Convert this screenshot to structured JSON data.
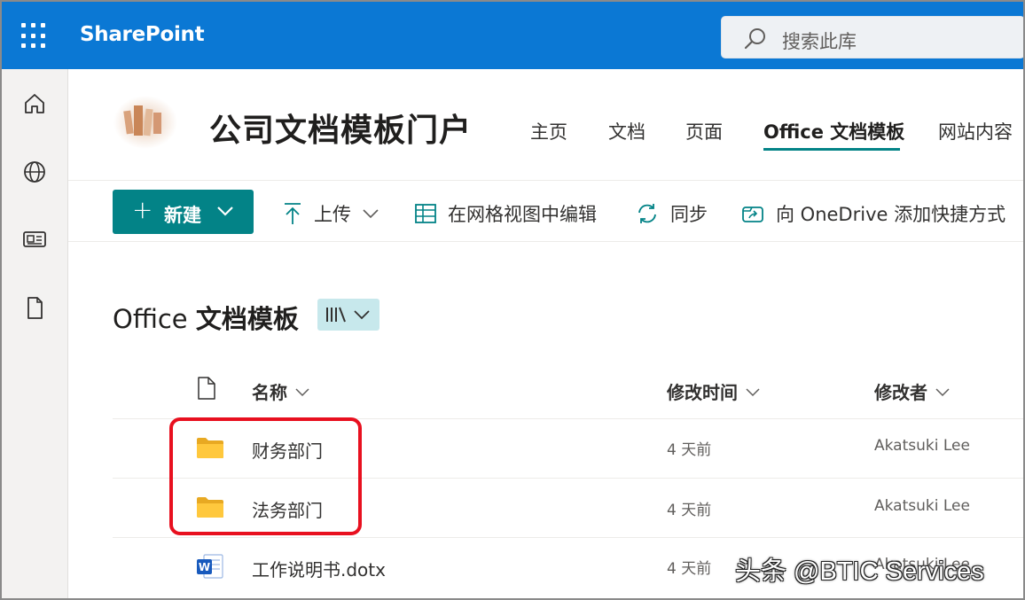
{
  "app": {
    "brand": "SharePoint",
    "search_placeholder": "搜索此库",
    "accent": "#038387",
    "topbar_color": "#0b78d4"
  },
  "rail": {
    "items": [
      {
        "name": "home",
        "icon": "home-icon"
      },
      {
        "name": "sites",
        "icon": "globe-icon"
      },
      {
        "name": "news",
        "icon": "news-icon"
      },
      {
        "name": "files",
        "icon": "document-icon"
      }
    ]
  },
  "site": {
    "title": "公司文档模板门户",
    "nav": [
      {
        "label": "主页"
      },
      {
        "label": "文档"
      },
      {
        "label": "页面"
      },
      {
        "label": "Office 文档模板",
        "active": true
      },
      {
        "label": "网站内容"
      }
    ]
  },
  "commands": {
    "new_label": "新建",
    "upload_label": "上传",
    "grid_edit_label": "在网格视图中编辑",
    "sync_label": "同步",
    "shortcut_label": "向 OneDrive 添加快捷方式"
  },
  "library": {
    "title_prefix": "Office",
    "title_main": "文档模板",
    "view_icon": "library-view-icon"
  },
  "list": {
    "columns": {
      "name": "名称",
      "modified": "修改时间",
      "modified_by": "修改者"
    },
    "rows": [
      {
        "type": "folder",
        "name": "财务部门",
        "modified": "4 天前",
        "modified_by": "Akatsuki Lee"
      },
      {
        "type": "folder",
        "name": "法务部门",
        "modified": "4 天前",
        "modified_by": "Akatsuki Lee"
      },
      {
        "type": "word-template",
        "name": "工作说明书.dotx",
        "modified": "4 天前",
        "modified_by": "Akatsuki Lee"
      }
    ]
  },
  "watermark": "头条 @BTIC Services"
}
